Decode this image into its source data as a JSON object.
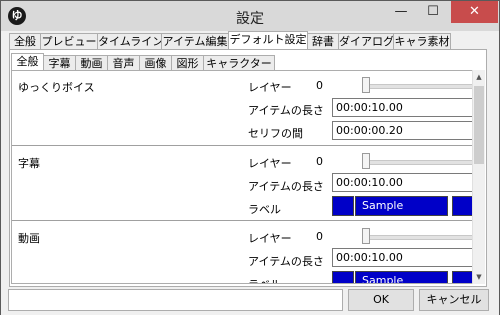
{
  "window": {
    "title": "設定",
    "app_icon_text": "ゆ",
    "controls": {
      "minimize": "—",
      "maximize": "☐",
      "close": "✕"
    }
  },
  "main_tabs": [
    "全般",
    "プレビュー",
    "タイムライン",
    "アイテム編集",
    "デフォルト設定",
    "辞書",
    "ダイアログ",
    "キャラ素材"
  ],
  "main_tabs_active": "デフォルト設定",
  "sub_tabs": [
    "全般",
    "字幕",
    "動画",
    "音声",
    "画像",
    "図形",
    "キャラクター"
  ],
  "sub_tabs_active": "全般",
  "sections": [
    {
      "label": "ゆっくりボイス",
      "layer_label": "レイヤー",
      "layer_value": "0",
      "rows": [
        {
          "label": "アイテムの長さ",
          "value": "00:00:10.00"
        },
        {
          "label": "セリフの間",
          "value": "00:00:00.20"
        }
      ]
    },
    {
      "label": "字幕",
      "layer_label": "レイヤー",
      "layer_value": "0",
      "rows": [
        {
          "label": "アイテムの長さ",
          "value": "00:00:10.00"
        }
      ],
      "color_label": "ラベル",
      "color_sample": "Sample"
    },
    {
      "label": "動画",
      "layer_label": "レイヤー",
      "layer_value": "0",
      "rows": [
        {
          "label": "アイテムの長さ",
          "value": "00:00:10.00"
        }
      ],
      "color_label": "ラベル",
      "color_sample": "Sample"
    }
  ],
  "colors": {
    "label_blue": "#0000c8",
    "close_red": "#c84c4c"
  },
  "buttons": {
    "ok": "OK",
    "cancel": "キャンセル"
  }
}
